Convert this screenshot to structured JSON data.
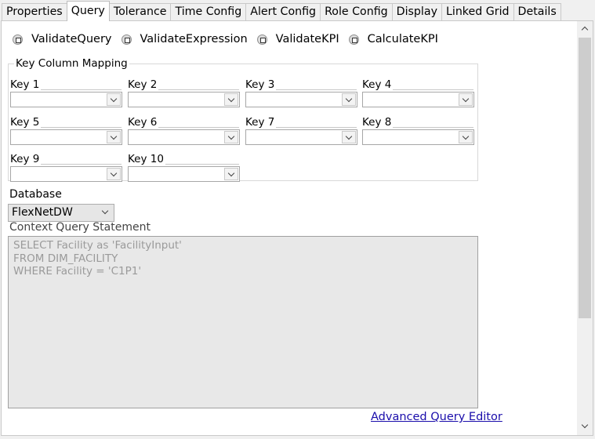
{
  "tabs": [
    {
      "label": "Properties",
      "active": false
    },
    {
      "label": "Query",
      "active": true
    },
    {
      "label": "Tolerance",
      "active": false
    },
    {
      "label": "Time Config",
      "active": false
    },
    {
      "label": "Alert Config",
      "active": false
    },
    {
      "label": "Role Config",
      "active": false
    },
    {
      "label": "Display",
      "active": false
    },
    {
      "label": "Linked Grid",
      "active": false
    },
    {
      "label": "Details",
      "active": false
    }
  ],
  "checkboxes": [
    {
      "label": "ValidateQuery"
    },
    {
      "label": "ValidateExpression"
    },
    {
      "label": "ValidateKPI"
    },
    {
      "label": "CalculateKPI"
    }
  ],
  "key_mapping": {
    "legend": "Key Column Mapping",
    "keys": [
      {
        "label": "Key 1",
        "value": ""
      },
      {
        "label": "Key 2",
        "value": ""
      },
      {
        "label": "Key 3",
        "value": ""
      },
      {
        "label": "Key 4",
        "value": ""
      },
      {
        "label": "Key 5",
        "value": ""
      },
      {
        "label": "Key 6",
        "value": ""
      },
      {
        "label": "Key 7",
        "value": ""
      },
      {
        "label": "Key 8",
        "value": ""
      },
      {
        "label": "Key 9",
        "value": ""
      },
      {
        "label": "Key 10",
        "value": ""
      }
    ]
  },
  "database": {
    "label": "Database",
    "selected": "FlexNetDW"
  },
  "context_query": {
    "label": "Context Query Statement",
    "text": "SELECT Facility as 'FacilityInput'\nFROM DIM_FACILITY\nWHERE Facility = 'C1P1'"
  },
  "advanced_link": "Advanced Query Editor",
  "colors": {
    "link": "#1a0dab",
    "query_background": "#e8e8e8",
    "query_text": "#9a9a9a"
  }
}
